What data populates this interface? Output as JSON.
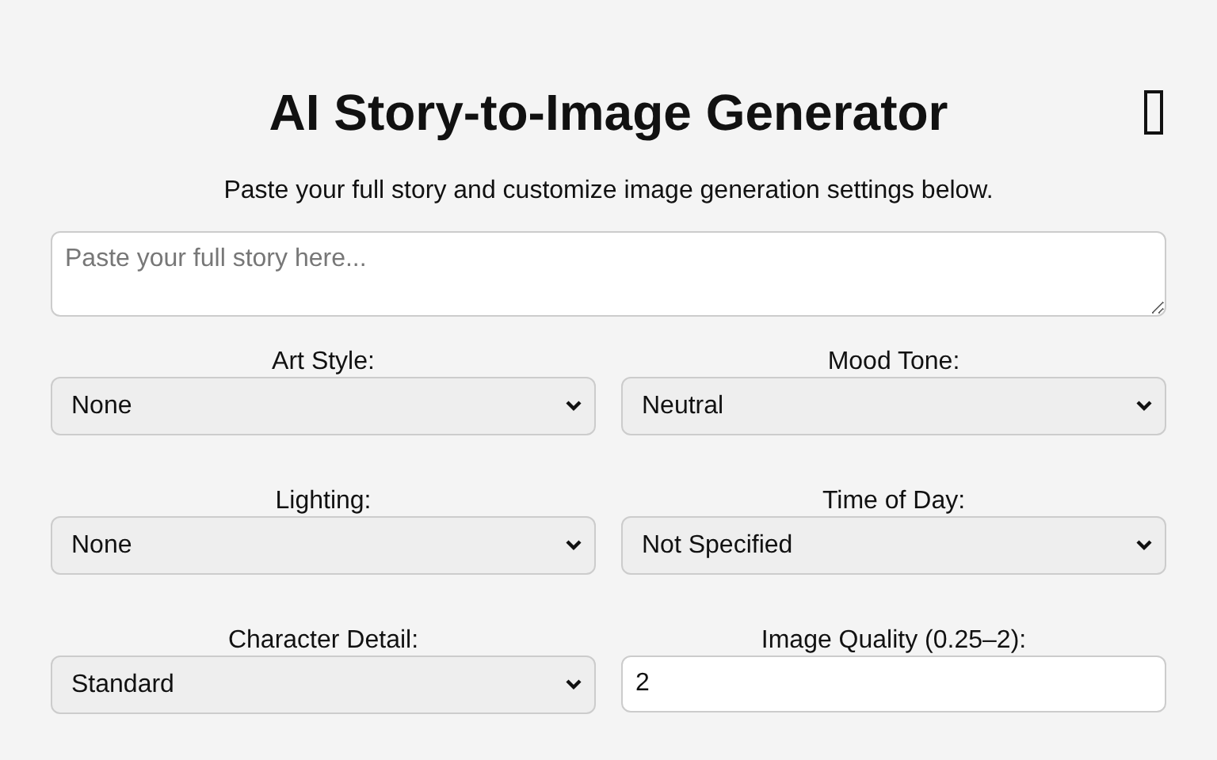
{
  "title": "AI Story-to-Image Generator",
  "subtitle": "Paste your full story and customize image generation settings below.",
  "story": {
    "placeholder": "Paste your full story here..."
  },
  "settings": [
    {
      "label": "Art Style:",
      "kind": "select",
      "value": "None"
    },
    {
      "label": "Mood Tone:",
      "kind": "select",
      "value": "Neutral"
    },
    {
      "label": "Lighting:",
      "kind": "select",
      "value": "None"
    },
    {
      "label": "Time of Day:",
      "kind": "select",
      "value": "Not Specified"
    },
    {
      "label": "Character Detail:",
      "kind": "select",
      "value": "Standard"
    },
    {
      "label": "Image Quality (0.25–2):",
      "kind": "number",
      "value": "2"
    }
  ]
}
